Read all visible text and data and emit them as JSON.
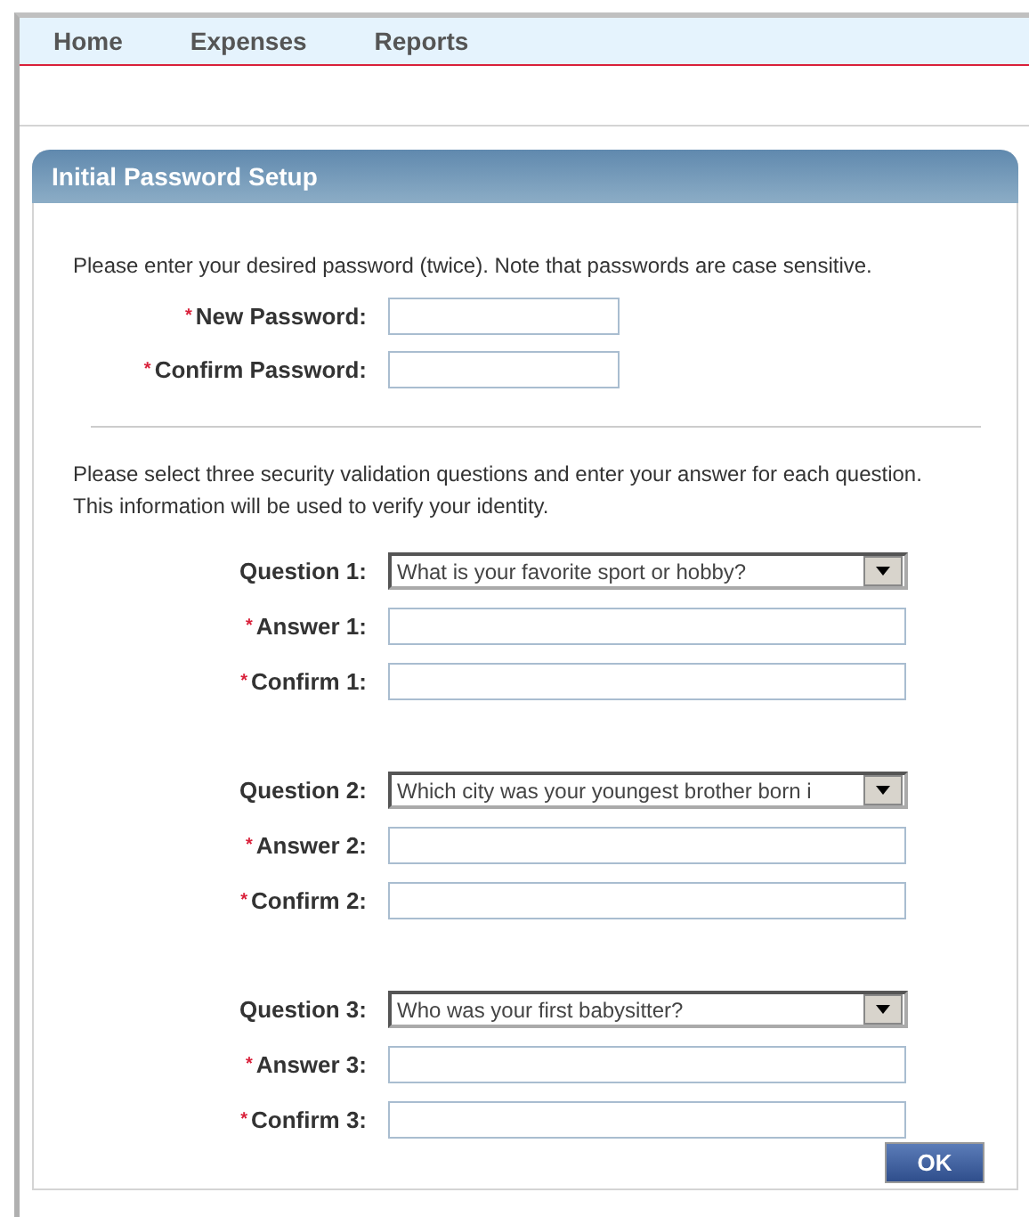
{
  "nav": {
    "items": [
      {
        "label": "Home"
      },
      {
        "label": "Expenses"
      },
      {
        "label": "Reports"
      }
    ]
  },
  "panel": {
    "title": "Initial Password Setup",
    "required_marker": "*",
    "intro": "Please enter your desired password (twice). Note that passwords are case sensitive.",
    "password_fields": [
      {
        "label": "New Password:",
        "required": true
      },
      {
        "label": "Confirm Password:",
        "required": true
      }
    ],
    "questions_intro": "Please select three security validation questions and enter your answer for each question. This information will be used to verify your identity.",
    "question_groups": [
      {
        "fields": [
          {
            "kind": "select",
            "label": "Question 1:",
            "required": false,
            "value": "What is your favorite sport or hobby?"
          },
          {
            "kind": "text",
            "label": "Answer 1:",
            "required": true
          },
          {
            "kind": "text",
            "label": "Confirm 1:",
            "required": true
          }
        ]
      },
      {
        "fields": [
          {
            "kind": "select",
            "label": "Question 2:",
            "required": false,
            "value": "Which city was your youngest brother born i"
          },
          {
            "kind": "text",
            "label": "Answer 2:",
            "required": true
          },
          {
            "kind": "text",
            "label": "Confirm 2:",
            "required": true
          }
        ]
      },
      {
        "fields": [
          {
            "kind": "select",
            "label": "Question 3:",
            "required": false,
            "value": "Who was your first babysitter?"
          },
          {
            "kind": "text",
            "label": "Answer 3:",
            "required": true
          },
          {
            "kind": "text",
            "label": "Confirm 3:",
            "required": true
          }
        ]
      }
    ],
    "ok_button": "OK"
  }
}
